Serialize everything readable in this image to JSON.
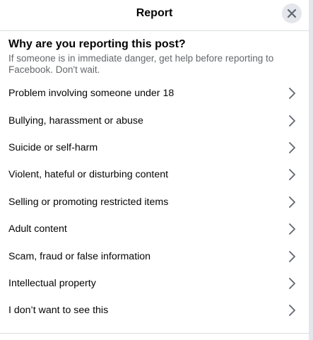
{
  "dialog": {
    "title": "Report",
    "close_icon": "close-icon"
  },
  "intro": {
    "heading": "Why are you reporting this post?",
    "text": "If someone is in immediate danger, get help before reporting to Facebook. Don't wait."
  },
  "reasons": [
    {
      "label": "Problem involving someone under 18",
      "icon": "chevron-right-icon"
    },
    {
      "label": "Bullying, harassment or abuse",
      "icon": "chevron-right-icon"
    },
    {
      "label": "Suicide or self-harm",
      "icon": "chevron-right-icon"
    },
    {
      "label": "Violent, hateful or disturbing content",
      "icon": "chevron-right-icon"
    },
    {
      "label": "Selling or promoting restricted items",
      "icon": "chevron-right-icon"
    },
    {
      "label": "Adult content",
      "icon": "chevron-right-icon"
    },
    {
      "label": "Scam, fraud or false information",
      "icon": "chevron-right-icon"
    },
    {
      "label": "Intellectual property",
      "icon": "chevron-right-icon"
    },
    {
      "label": "I don’t want to see this",
      "icon": "chevron-right-icon"
    }
  ],
  "colors": {
    "primary_text": "#050505",
    "secondary_text": "#65676b",
    "close_button_bg": "#e4e6eb",
    "divider": "#dadde1"
  }
}
